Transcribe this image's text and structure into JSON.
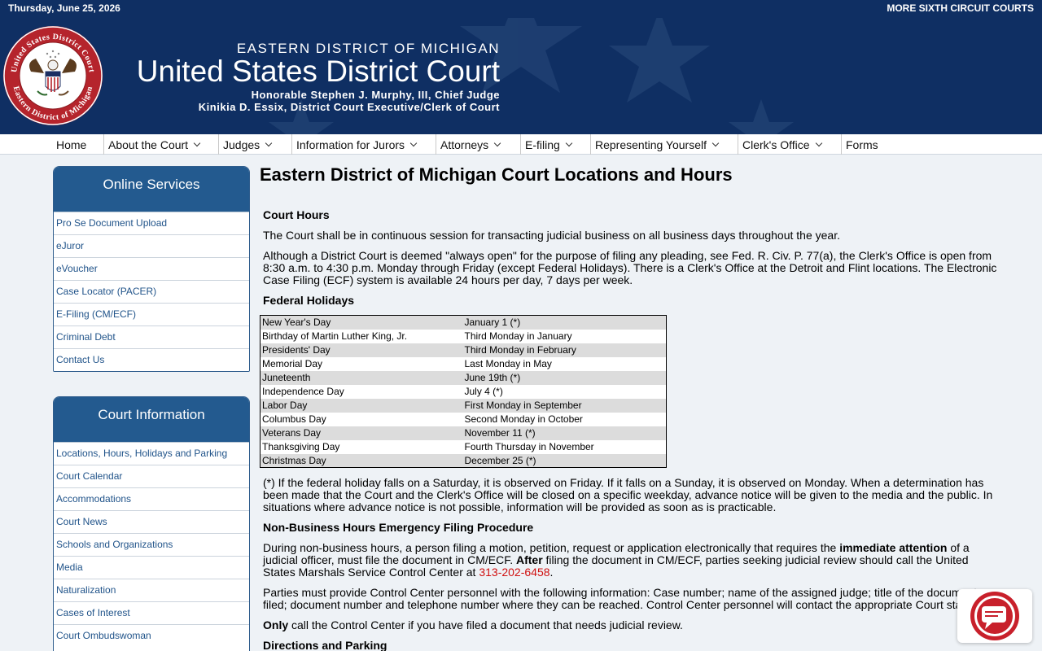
{
  "topbar": {
    "date": "Thursday, June 25, 2026",
    "more_link": "MORE SIXTH CIRCUIT COURTS"
  },
  "header": {
    "district": "EASTERN DISTRICT OF MICHIGAN",
    "court": "United States District Court",
    "judge": "Honorable Stephen J. Murphy, III, Chief Judge",
    "clerk": "Kinikia D. Essix, District Court Executive/Clerk of Court",
    "seal_text_top": "United States District Court",
    "seal_text_bottom": "Eastern District of Michigan"
  },
  "nav": [
    {
      "label": "Home",
      "dropdown": false
    },
    {
      "label": "About the Court",
      "dropdown": true
    },
    {
      "label": "Judges",
      "dropdown": true
    },
    {
      "label": "Information for Jurors",
      "dropdown": true
    },
    {
      "label": "Attorneys",
      "dropdown": true
    },
    {
      "label": "E-filing",
      "dropdown": true
    },
    {
      "label": "Representing Yourself",
      "dropdown": true
    },
    {
      "label": "Clerk's Office",
      "dropdown": true
    },
    {
      "label": "Forms",
      "dropdown": false
    }
  ],
  "sidebar": {
    "online": {
      "title": "Online Services",
      "links": [
        "Pro Se Document Upload",
        "eJuror",
        "eVoucher",
        "Case Locator (PACER)",
        "E-Filing (CM/ECF)",
        "Criminal Debt",
        "Contact Us"
      ]
    },
    "court_info": {
      "title": "Court Information",
      "links": [
        "Locations, Hours, Holidays and Parking",
        "Court Calendar",
        "Accommodations",
        "Court News",
        "Schools and Organizations",
        "Media",
        "Naturalization",
        "Cases of Interest",
        "Court Ombudswoman"
      ]
    }
  },
  "main": {
    "title": "Eastern District of Michigan Court Locations and Hours",
    "court_hours_heading": "Court Hours",
    "court_hours_p1": "The Court shall be in continuous session for transacting judicial business on all business days throughout the year.",
    "court_hours_p2": "Although a District Court is deemed \"always open\" for the purpose of filing any pleading, see Fed. R. Civ. P. 77(a), the Clerk's Office is open from 8:30 a.m. to 4:30 p.m. Monday through Friday (except Federal Holidays). There is a Clerk's Office at the Detroit and Flint locations. The Electronic Case Filing (ECF) system is available 24 hours per day, 7 days per week.",
    "holidays_heading": "Federal Holidays",
    "holidays": [
      [
        "New Year's Day",
        "January 1 (*)"
      ],
      [
        "Birthday of Martin Luther King, Jr.",
        "Third Monday in January"
      ],
      [
        "Presidents' Day",
        "Third Monday in February"
      ],
      [
        "Memorial Day",
        "Last Monday in May"
      ],
      [
        "Juneteenth",
        "June 19th (*)"
      ],
      [
        "Independence Day",
        "July 4 (*)"
      ],
      [
        "Labor Day",
        "First Monday in September"
      ],
      [
        "Columbus Day",
        "Second Monday in October"
      ],
      [
        "Veterans Day",
        "November 11 (*)"
      ],
      [
        "Thanksgiving Day",
        "Fourth Thursday in November"
      ],
      [
        "Christmas Day",
        "December 25 (*)"
      ]
    ],
    "holiday_note": "(*) If the federal holiday falls on a Saturday, it is observed on Friday. If it falls on a Sunday, it is observed on Monday. When a determination has been made that the Court and the Clerk's Office will be closed on a specific weekday, advance notice will be given to the media and the public. In situations where advance notice is not possible, information will be provided as soon as is practicable.",
    "emergency_heading": "Non-Business Hours Emergency Filing Procedure",
    "emergency_p1_a": "During non-business hours, a person filing a motion, petition, request or application electronically that requires the ",
    "emergency_p1_bold1": "immediate attention",
    "emergency_p1_b": " of a judicial officer, must file the document in CM/ECF. ",
    "emergency_p1_bold2": "After",
    "emergency_p1_c": " filing the document in CM/ECF, parties seeking judicial review should call the United States Marshals Service Control Center at ",
    "emergency_phone": "313-202-6458",
    "emergency_p1_d": ".",
    "emergency_p2": "Parties must provide Control Center personnel with the following information: Case number; name of the assigned judge; title of the document filed; document number and telephone number where they can be reached. Control Center personnel will contact the appropriate Court staff.",
    "emergency_p3_bold": "Only",
    "emergency_p3": " call the Control Center if you have filed a document that needs judicial review.",
    "directions_heading": "Directions and Parking"
  },
  "colors": {
    "navy": "#0f2f63",
    "sidebar_head": "#235a8f",
    "link": "#21548a",
    "phone": "#d01010"
  },
  "icons": {
    "chat": "chat-bubble-icon",
    "seal": "court-seal-icon"
  }
}
